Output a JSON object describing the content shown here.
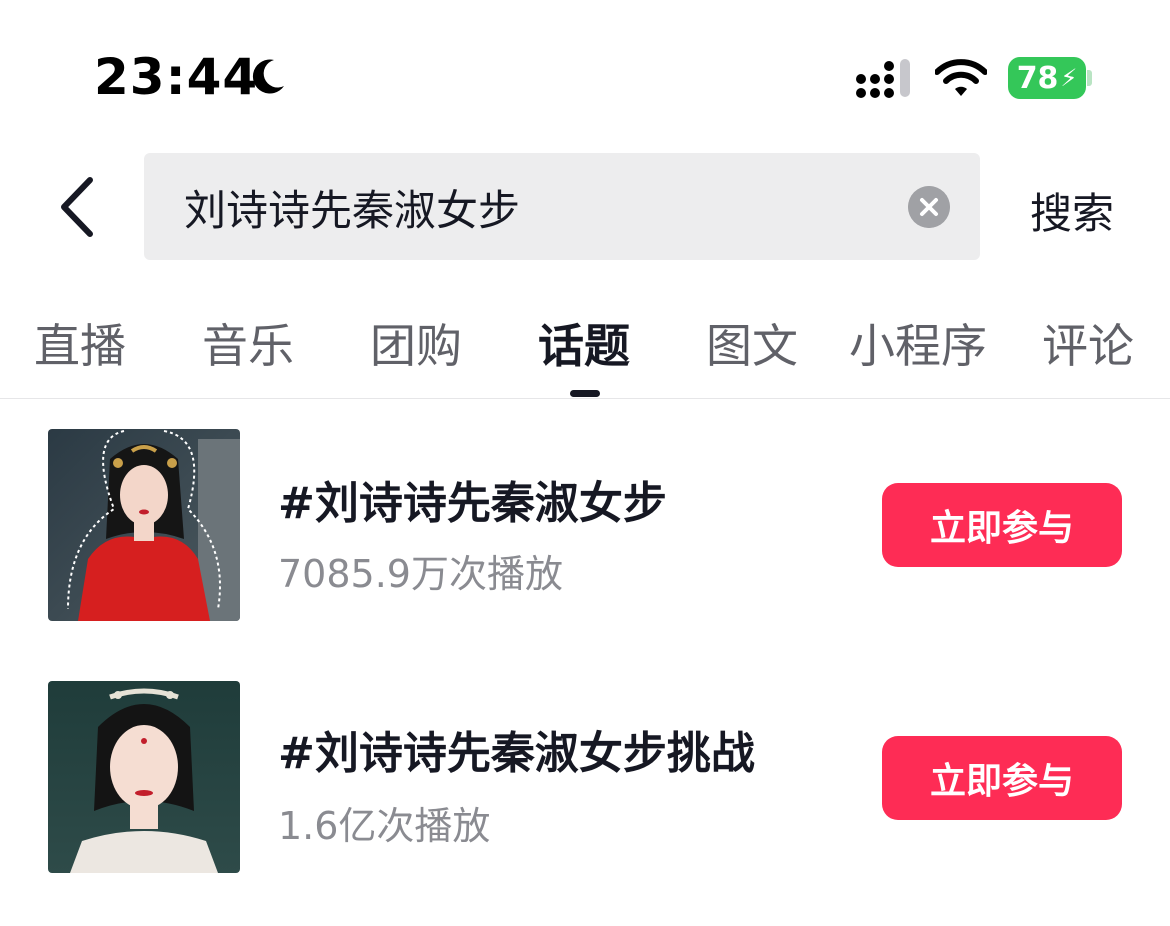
{
  "status_bar": {
    "time": "23:44",
    "battery": "78",
    "icons": [
      "moon-icon",
      "cellular-signal-icon",
      "wifi-icon",
      "battery-charging-icon"
    ]
  },
  "search": {
    "query": "刘诗诗先秦淑女步",
    "submit_label": "搜索",
    "icons": [
      "back-chevron-icon",
      "clear-icon"
    ]
  },
  "tabs": [
    {
      "label": "直播",
      "active": false
    },
    {
      "label": "音乐",
      "active": false
    },
    {
      "label": "团购",
      "active": false
    },
    {
      "label": "话题",
      "active": true
    },
    {
      "label": "图文",
      "active": false
    },
    {
      "label": "小程序",
      "active": false
    },
    {
      "label": "评论",
      "active": false
    }
  ],
  "topics": [
    {
      "title": "#刘诗诗先秦淑女步",
      "plays": "7085.9万次播放",
      "action": "立即参与"
    },
    {
      "title": "#刘诗诗先秦淑女步挑战",
      "plays": "1.6亿次播放",
      "action": "立即参与"
    }
  ],
  "colors": {
    "accent": "#fe2c55",
    "battery": "#34c759",
    "search_bg": "#ededee"
  }
}
